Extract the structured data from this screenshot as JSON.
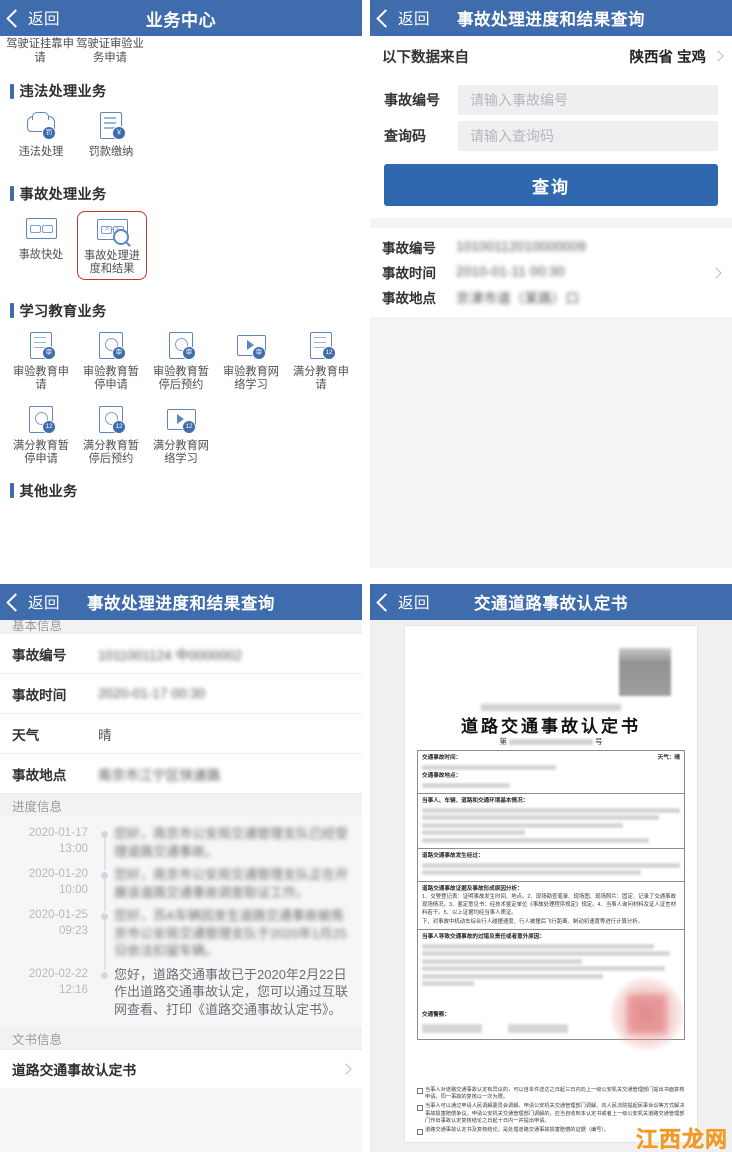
{
  "panels": {
    "business_center": {
      "header": {
        "back": "返回",
        "title": "业务中心"
      },
      "cut_items": [
        {
          "label": "驾驶证挂靠申请"
        },
        {
          "label": "驾驶证审验业务申请"
        }
      ],
      "sections": [
        {
          "title": "违法处理业务",
          "items": [
            {
              "label": "违法处理",
              "icon": "car-violation-icon",
              "badge": "罚",
              "highlight": false
            },
            {
              "label": "罚款缴纳",
              "icon": "document-payment-icon",
              "badge": "￥",
              "highlight": false
            }
          ]
        },
        {
          "title": "事故处理业务",
          "items": [
            {
              "label": "事故快处",
              "icon": "accident-scene-icon",
              "badge": "",
              "highlight": false
            },
            {
              "label": "事故处理进度和结果",
              "icon": "accident-progress-search-icon",
              "badge": "",
              "highlight": true
            }
          ]
        },
        {
          "title": "学习教育业务",
          "items": [
            {
              "label": "审验教育申请",
              "icon": "exam-doc-icon",
              "badge": "审",
              "highlight": false
            },
            {
              "label": "审验教育暂停申请",
              "icon": "exam-pause-icon",
              "badge": "审",
              "highlight": false
            },
            {
              "label": "审验教育暂停后预约",
              "icon": "exam-clock-icon",
              "badge": "审",
              "highlight": false
            },
            {
              "label": "审验教育网络学习",
              "icon": "exam-video-icon",
              "badge": "审",
              "highlight": false
            },
            {
              "label": "满分教育申请",
              "icon": "fullscore-doc-icon",
              "badge": "12",
              "highlight": false
            },
            {
              "label": "满分教育暂停申请",
              "icon": "fullscore-pause-icon",
              "badge": "12",
              "highlight": false
            },
            {
              "label": "满分教育暂停后预约",
              "icon": "fullscore-clock-icon",
              "badge": "12",
              "highlight": false
            },
            {
              "label": "满分教育网络学习",
              "icon": "fullscore-video-icon",
              "badge": "12",
              "highlight": false
            }
          ]
        },
        {
          "title": "其他业务",
          "items": []
        }
      ]
    },
    "query_form": {
      "header": {
        "back": "返回",
        "title": "事故处理进度和结果查询"
      },
      "source_label": "以下数据来自",
      "source_value": "陕西省 宝鸡",
      "fields": [
        {
          "label": "事故编号",
          "value": "",
          "placeholder": "请输入事故编号"
        },
        {
          "label": "查询码",
          "value": "",
          "placeholder": "请输入查询码"
        }
      ],
      "submit_label": "查询",
      "result_rows": [
        {
          "label": "事故编号",
          "value": "10100112010000009",
          "blurred": true
        },
        {
          "label": "事故时间",
          "value": "2010-01-11 00:30",
          "blurred": true
        },
        {
          "label": "事故地点",
          "value": "京津市道（某路）口",
          "blurred": true
        }
      ]
    },
    "detail": {
      "header": {
        "back": "返回",
        "title": "事故处理进度和结果查询"
      },
      "basic_group": "基本信息",
      "rows": [
        {
          "label": "事故编号",
          "value": "1011001124 中0000002",
          "blurred": true
        },
        {
          "label": "事故时间",
          "value": "2020-01-17 00:30",
          "blurred": true
        },
        {
          "label": "天气",
          "value": "晴",
          "blurred": false
        },
        {
          "label": "事故地点",
          "value": "南京市江宁区快速路",
          "blurred": true
        }
      ],
      "progress_group": "进度信息",
      "timeline": [
        {
          "date": "2020-01-17",
          "time": "13:00",
          "text": "您好，南京市公安局交通管理支队已经受理道路交通事故。"
        },
        {
          "date": "2020-01-20",
          "time": "10:00",
          "text": "您好，南京市公安局交通管理支队正在开展该道路交通事故调查取证工作。"
        },
        {
          "date": "2020-01-25",
          "time": "09:23",
          "text": "您好，苏A车辆因发生道路交通事故被南京市公安局交通管理支队于2020年1月25日依法扣留车辆。"
        },
        {
          "date": "2020-02-22",
          "time": "12:16",
          "text": "您好，道路交通事故已于2020年2月22日作出道路交通事故认定，您可以通过互联网查看、打印《道路交通事故认定书》。"
        }
      ],
      "doc_group": "文书信息",
      "doc_item": "道路交通事故认定书"
    },
    "certificate": {
      "header": {
        "back": "返回",
        "title": "交通道路事故认定书"
      },
      "doc_title": "道路交通事故认定书",
      "doc_no_prefix": "第",
      "doc_no_suffix": "号",
      "table_sections": [
        {
          "label": "交通事故时间：",
          "extra": "天气：晴"
        },
        {
          "label": "交通事故地点：",
          "extra": ""
        },
        {
          "label": "当事人、车辆、道路和交通环境基本情况：",
          "extra": ""
        },
        {
          "label": "道路交通事故发生经过：",
          "extra": ""
        },
        {
          "label": "道路交通事故证据及事故形成原因分析：",
          "extra": ""
        },
        {
          "label": "当事人导致交通事故的过错及责任或者意外原因：",
          "extra": ""
        },
        {
          "label": "交通警察：",
          "extra": ""
        }
      ],
      "footer_notes": [
        "当事人对道路交通事故认定有异议的，可以自本件送达之日起三日内向上一级公安机关交通管理部门提出书面复核申请。同一事故的复核以一次为限。",
        "当事人可以通过申请人民调解委员会调解、申请公安机关交通管理部门调解、向人民法院提起民事诉讼等方式解决事故损害赔偿争议。申请公安机关交通管理部门调解的，应当自收到本认定书或者上一级公安机关道路交通管理部门作出事故认定复核结论之日起十日内一并提出申请。",
        "道路交通事故认定书及复核结论，是处理道路交通事故损害赔偿的证据（编号）。"
      ],
      "watermark": "江西龙网"
    }
  },
  "colors": {
    "header_blue": "#3f6cad",
    "button_blue": "#2f68ae",
    "highlight_red": "#c0392b",
    "watermark_orange": "#f59a1e"
  }
}
